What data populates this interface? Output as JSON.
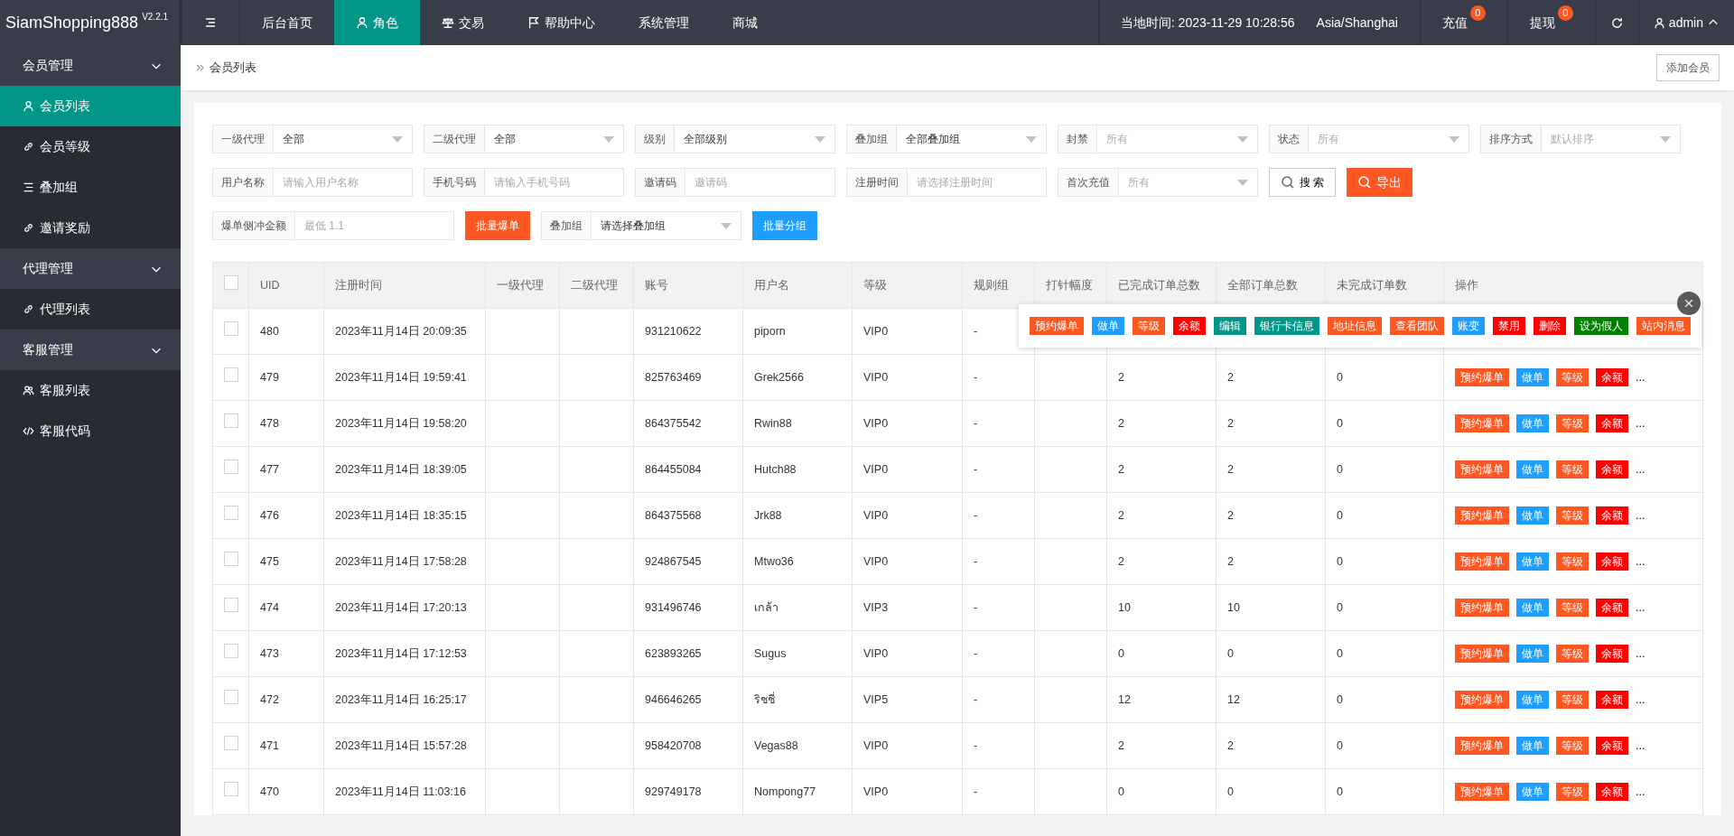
{
  "brand": {
    "name": "SiamShopping888",
    "version": "V2.2.1"
  },
  "top_nav": [
    {
      "label": "后台首页",
      "kind": "plain",
      "selected": false
    },
    {
      "label": "角色",
      "kind": "person",
      "selected": true
    },
    {
      "label": "交易",
      "kind": "scale",
      "selected": false
    },
    {
      "label": "帮助中心",
      "kind": "flag",
      "selected": false
    },
    {
      "label": "系统管理",
      "kind": "plain",
      "selected": false
    },
    {
      "label": "商城",
      "kind": "plain",
      "selected": false
    }
  ],
  "top_right": {
    "time": "当地时间: 2023-11-29 10:28:56",
    "timezone": "Asia/Shanghai",
    "links": [
      {
        "label": "充值",
        "badge": "0"
      },
      {
        "label": "提现",
        "badge": "0"
      }
    ],
    "user": "admin"
  },
  "sidebar": [
    {
      "label": "会员管理",
      "expanded": true,
      "children": [
        {
          "label": "会员列表",
          "kind": "person",
          "selected": true
        },
        {
          "label": "会员等级",
          "kind": "link",
          "selected": false
        },
        {
          "label": "叠加组",
          "kind": "list",
          "selected": false
        },
        {
          "label": "邀请奖励",
          "kind": "link",
          "selected": false
        }
      ]
    },
    {
      "label": "代理管理",
      "expanded": true,
      "children": [
        {
          "label": "代理列表",
          "kind": "link",
          "selected": false
        }
      ]
    },
    {
      "label": "客服管理",
      "expanded": true,
      "children": [
        {
          "label": "客服列表",
          "kind": "people",
          "selected": false
        },
        {
          "label": "客服代码",
          "kind": "code",
          "selected": false
        }
      ]
    }
  ],
  "breadcrumb": "会员列表",
  "add_button": "添加会员",
  "filters": [
    [
      {
        "kind": "select",
        "label": "一级代理",
        "value": "全部"
      },
      {
        "kind": "select",
        "label": "二级代理",
        "value": "全部"
      },
      {
        "kind": "select",
        "label": "级别",
        "value": "全部级别"
      },
      {
        "kind": "select",
        "label": "叠加组",
        "value": "全部叠加组"
      },
      {
        "kind": "select",
        "label": "封禁",
        "placeholder": "所有"
      },
      {
        "kind": "select",
        "label": "状态",
        "placeholder": "所有"
      },
      {
        "kind": "select",
        "label": "排序方式",
        "placeholder": "默认排序"
      }
    ],
    [
      {
        "kind": "input",
        "label": "用户名称",
        "placeholder": "请输入用户名称"
      },
      {
        "kind": "input",
        "label": "手机号码",
        "placeholder": "请输入手机号码"
      },
      {
        "kind": "input",
        "label": "邀请码",
        "placeholder": "邀请码"
      },
      {
        "kind": "input",
        "label": "注册时间",
        "placeholder": "请选择注册时间"
      },
      {
        "kind": "select",
        "label": "首次充值",
        "placeholder": "所有"
      },
      {
        "kind": "search",
        "label": "搜 索"
      },
      {
        "kind": "export",
        "label": "导出",
        "color": "#ff5722"
      }
    ],
    [
      {
        "kind": "input",
        "label": "爆单侧冲金额",
        "placeholder": "最低 1.1"
      },
      {
        "kind": "button",
        "label": "批量爆单",
        "color": "#ff5722"
      },
      {
        "kind": "select",
        "label": "叠加组",
        "value": "请选择叠加组"
      },
      {
        "kind": "button",
        "label": "批量分组",
        "color": "#1e9fff"
      }
    ]
  ],
  "table": {
    "columns": [
      "UID",
      "注册时间",
      "一级代理",
      "二级代理",
      "账号",
      "用户名",
      "等级",
      "规则组",
      "打针幅度",
      "已完成订单总数",
      "全部订单总数",
      "未完成订单数",
      "操作"
    ],
    "all_checked": false,
    "rows": [
      {
        "checked": false,
        "cells": [
          "480",
          "2023年11月14日 20:09:35",
          "",
          "",
          "931210622",
          "piporn",
          "VIP0",
          "-"
        ]
      },
      {
        "checked": false,
        "cells": [
          "479",
          "2023年11月14日 19:59:41",
          "",
          "",
          "825763469",
          "Grek2566",
          "VIP0",
          "-",
          "",
          "2",
          "2",
          "0"
        ],
        "actions": [
          {
            "label": "预约爆单",
            "color": "#ff5722"
          },
          {
            "label": "做单",
            "color": "#1e9fff"
          },
          {
            "label": "等级",
            "color": "#ff5722"
          },
          {
            "label": "余额",
            "color": "#ff0000"
          }
        ],
        "more": "..."
      },
      {
        "checked": false,
        "cells": [
          "478",
          "2023年11月14日 19:58:20",
          "",
          "",
          "864375542",
          "Rwin88",
          "VIP0",
          "-",
          "",
          "2",
          "2",
          "0"
        ],
        "actions": [
          {
            "label": "预约爆单",
            "color": "#ff5722"
          },
          {
            "label": "做单",
            "color": "#1e9fff"
          },
          {
            "label": "等级",
            "color": "#ff5722"
          },
          {
            "label": "余额",
            "color": "#ff0000"
          }
        ],
        "more": "..."
      },
      {
        "checked": false,
        "cells": [
          "477",
          "2023年11月14日 18:39:05",
          "",
          "",
          "864455084",
          "Hutch88",
          "VIP0",
          "-",
          "",
          "2",
          "2",
          "0"
        ],
        "actions": [
          {
            "label": "预约爆单",
            "color": "#ff5722"
          },
          {
            "label": "做单",
            "color": "#1e9fff"
          },
          {
            "label": "等级",
            "color": "#ff5722"
          },
          {
            "label": "余额",
            "color": "#ff0000"
          }
        ],
        "more": "..."
      },
      {
        "checked": false,
        "cells": [
          "476",
          "2023年11月14日 18:35:15",
          "",
          "",
          "864375568",
          "Jrk88",
          "VIP0",
          "-",
          "",
          "2",
          "2",
          "0"
        ],
        "actions": [
          {
            "label": "预约爆单",
            "color": "#ff5722"
          },
          {
            "label": "做单",
            "color": "#1e9fff"
          },
          {
            "label": "等级",
            "color": "#ff5722"
          },
          {
            "label": "余额",
            "color": "#ff0000"
          }
        ],
        "more": "..."
      },
      {
        "checked": false,
        "cells": [
          "475",
          "2023年11月14日 17:58:28",
          "",
          "",
          "924867545",
          "Mtwo36",
          "VIP0",
          "-",
          "",
          "2",
          "2",
          "0"
        ],
        "actions": [
          {
            "label": "预约爆单",
            "color": "#ff5722"
          },
          {
            "label": "做单",
            "color": "#1e9fff"
          },
          {
            "label": "等级",
            "color": "#ff5722"
          },
          {
            "label": "余额",
            "color": "#ff0000"
          }
        ],
        "more": "..."
      },
      {
        "checked": false,
        "cells": [
          "474",
          "2023年11月14日 17:20:13",
          "",
          "",
          "931496746",
          "เกล้า",
          "VIP3",
          "-",
          "",
          "10",
          "10",
          "0"
        ],
        "actions": [
          {
            "label": "预约爆单",
            "color": "#ff5722"
          },
          {
            "label": "做单",
            "color": "#1e9fff"
          },
          {
            "label": "等级",
            "color": "#ff5722"
          },
          {
            "label": "余额",
            "color": "#ff0000"
          }
        ],
        "more": "..."
      },
      {
        "checked": false,
        "cells": [
          "473",
          "2023年11月14日 17:12:53",
          "",
          "",
          "623893265",
          "Sugus",
          "VIP0",
          "-",
          "",
          "0",
          "0",
          "0"
        ],
        "actions": [
          {
            "label": "预约爆单",
            "color": "#ff5722"
          },
          {
            "label": "做单",
            "color": "#1e9fff"
          },
          {
            "label": "等级",
            "color": "#ff5722"
          },
          {
            "label": "余额",
            "color": "#ff0000"
          }
        ],
        "more": "..."
      },
      {
        "checked": false,
        "cells": [
          "472",
          "2023年11月14日 16:25:17",
          "",
          "",
          "946646265",
          "ริชชี่",
          "VIP5",
          "-",
          "",
          "12",
          "12",
          "0"
        ],
        "actions": [
          {
            "label": "预约爆单",
            "color": "#ff5722"
          },
          {
            "label": "做单",
            "color": "#1e9fff"
          },
          {
            "label": "等级",
            "color": "#ff5722"
          },
          {
            "label": "余额",
            "color": "#ff0000"
          }
        ],
        "more": "..."
      },
      {
        "checked": false,
        "cells": [
          "471",
          "2023年11月14日 15:57:28",
          "",
          "",
          "958420708",
          "Vegas88",
          "VIP0",
          "-",
          "",
          "2",
          "2",
          "0"
        ],
        "actions": [
          {
            "label": "预约爆单",
            "color": "#ff5722"
          },
          {
            "label": "做单",
            "color": "#1e9fff"
          },
          {
            "label": "等级",
            "color": "#ff5722"
          },
          {
            "label": "余额",
            "color": "#ff0000"
          }
        ],
        "more": "..."
      },
      {
        "checked": false,
        "cells": [
          "470",
          "2023年11月14日 11:03:16",
          "",
          "",
          "929749178",
          "Nompong77",
          "VIP0",
          "-",
          "",
          "0",
          "0",
          "0"
        ],
        "actions": [
          {
            "label": "预约爆单",
            "color": "#ff5722"
          },
          {
            "label": "做单",
            "color": "#1e9fff"
          },
          {
            "label": "等级",
            "color": "#ff5722"
          },
          {
            "label": "余额",
            "color": "#ff0000"
          }
        ],
        "more": "..."
      }
    ]
  },
  "action_popup": {
    "actions": [
      {
        "label": "预约爆单",
        "color": "#ff5722"
      },
      {
        "label": "做单",
        "color": "#1e9fff"
      },
      {
        "label": "等级",
        "color": "#ff5722"
      },
      {
        "label": "余额",
        "color": "#ff0000"
      },
      {
        "label": "编辑",
        "color": "#009688"
      },
      {
        "label": "银行卡信息",
        "color": "#009688"
      },
      {
        "label": "地址信息",
        "color": "#ff5722"
      },
      {
        "label": "查看团队",
        "color": "#ff5722"
      },
      {
        "label": "账变",
        "color": "#1e9fff"
      },
      {
        "label": "禁用",
        "color": "#ff0000"
      },
      {
        "label": "删除",
        "color": "#ff0000"
      },
      {
        "label": "设为假人",
        "color": "#008000"
      },
      {
        "label": "站内消息",
        "color": "#ff5722"
      }
    ]
  }
}
